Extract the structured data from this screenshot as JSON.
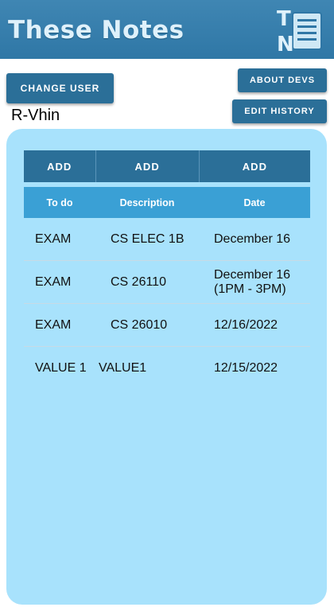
{
  "app": {
    "title": "These Notes",
    "logo_letters": [
      "T",
      "N"
    ]
  },
  "buttons": {
    "change_user": "CHANGE USER",
    "about_devs": "ABOUT DEVS",
    "edit_history": "EDIT HISTORY"
  },
  "user": {
    "name": "R-Vhin"
  },
  "table": {
    "add_buttons": [
      "ADD",
      "ADD",
      "ADD"
    ],
    "headers": [
      "To do",
      "Description",
      "Date"
    ],
    "rows": [
      {
        "todo": "EXAM",
        "description": "CS ELEC 1B",
        "date": "December 16"
      },
      {
        "todo": "EXAM",
        "description": "CS 26110",
        "date": "December 16 (1PM - 3PM)"
      },
      {
        "todo": "EXAM",
        "description": "CS 26010",
        "date": "12/16/2022"
      },
      {
        "todo": "VALUE 1",
        "description": "VALUE1",
        "date": "12/15/2022"
      }
    ]
  },
  "colors": {
    "header": "#3379a8",
    "button": "#2b6f98",
    "panel": "#a8e2fc",
    "table_header": "#3aa0d5"
  }
}
